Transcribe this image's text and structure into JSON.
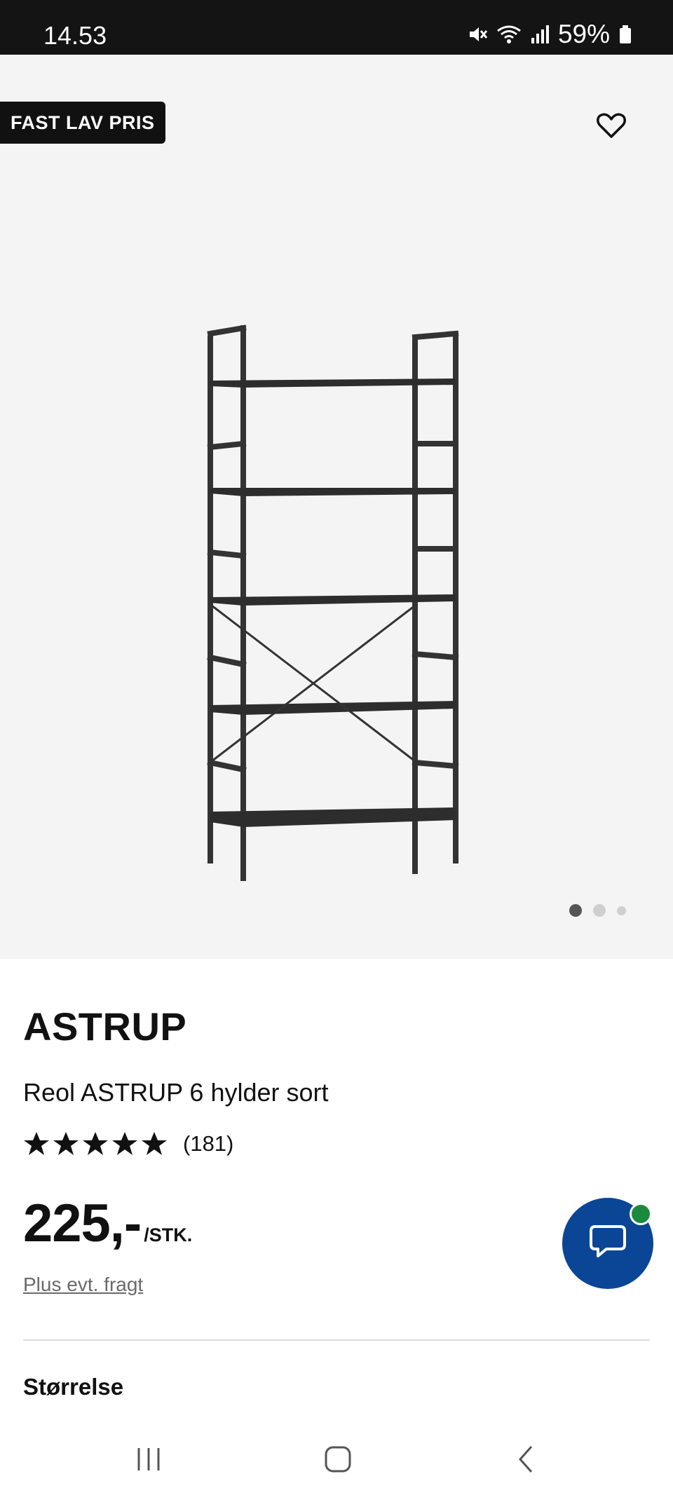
{
  "status_bar": {
    "time": "14.53",
    "battery": "59%",
    "icons": [
      "mute-icon",
      "wifi-icon",
      "signal-icon",
      "battery-icon"
    ]
  },
  "hero": {
    "badge": "FAST LAV PRIS",
    "favorite_icon": "heart-outline-icon",
    "carousel": {
      "count": 3,
      "active_index": 0
    }
  },
  "product": {
    "brand": "ASTRUP",
    "title": "Reol ASTRUP 6 hylder sort",
    "rating": {
      "stars": 5,
      "count_label": "(181)"
    },
    "price": {
      "amount": "225,-",
      "unit": "/STK."
    },
    "shipping_link": "Plus evt. fragt",
    "size_label": "Størrelse"
  },
  "chat": {
    "icon": "chat-bubble-icon",
    "status_color": "#1c8a3e",
    "bg_color": "#0b4596"
  },
  "navbar": {
    "icons": [
      "recent-apps-icon",
      "home-icon",
      "back-icon"
    ]
  }
}
